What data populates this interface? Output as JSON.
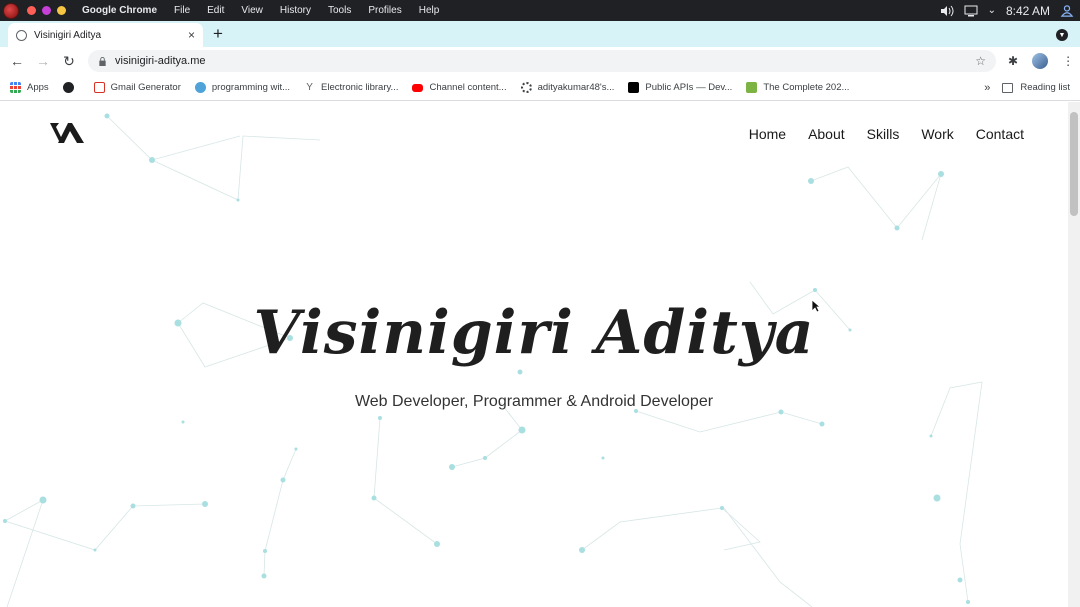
{
  "menubar": {
    "app_name": "Google Chrome",
    "menus": [
      "File",
      "Edit",
      "View",
      "History",
      "Tools",
      "Profiles",
      "Help"
    ],
    "clock": "8:42 AM"
  },
  "tab": {
    "title": "Visinigiri Aditya",
    "close": "×",
    "new_tab": "+"
  },
  "toolbar": {
    "back": "←",
    "forward": "→",
    "reload": "↻",
    "url": "visinigiri-aditya.me",
    "star": "☆"
  },
  "bookmarks": {
    "items": [
      {
        "label": "Apps",
        "icon": "apps-grid-icon",
        "color": "#ea4335"
      },
      {
        "label": "",
        "icon": "globe-icon",
        "color": "#202124"
      },
      {
        "label": "Gmail Generator",
        "icon": "gmail-icon",
        "color": "#d93025"
      },
      {
        "label": "programming wit...",
        "icon": "globe-icon",
        "color": "#4fa3d8"
      },
      {
        "label": "Electronic library...",
        "icon": "y-icon",
        "color": "#5f6368"
      },
      {
        "label": "Channel content...",
        "icon": "youtube-icon",
        "color": "#ff0000"
      },
      {
        "label": "adityakumar48's...",
        "icon": "spinner-icon",
        "color": "#3c4043"
      },
      {
        "label": "Public APIs — Dev...",
        "icon": "dev-icon",
        "color": "#000000"
      },
      {
        "label": "The Complete 202...",
        "icon": "c-icon",
        "color": "#7cb342"
      }
    ],
    "more": "»",
    "reading_list": "Reading list"
  },
  "page": {
    "nav": [
      "Home",
      "About",
      "Skills",
      "Work",
      "Contact"
    ],
    "title": "Visinigiri Aditya",
    "subtitle": "Web Developer, Programmer & Android Developer",
    "accent": "#7fd6d0"
  }
}
